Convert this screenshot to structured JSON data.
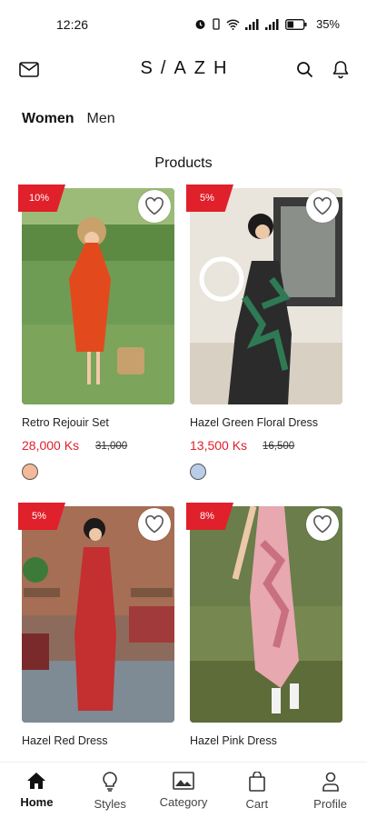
{
  "status_bar": {
    "time": "12:26",
    "battery": "35%"
  },
  "header": {
    "brand": "S/AZH"
  },
  "gender_tabs": [
    {
      "label": "Women",
      "active": true
    },
    {
      "label": "Men",
      "active": false
    }
  ],
  "section_title": "Products",
  "products": [
    {
      "name": "Retro Rejouir Set",
      "price": "28,000 Ks",
      "old_price": "31,000",
      "discount": "10%",
      "swatch": "#f4b89a"
    },
    {
      "name": "Hazel Green Floral Dress",
      "price": "13,500 Ks",
      "old_price": "16,500",
      "discount": "5%",
      "swatch": "#b9cde8"
    },
    {
      "name": "Hazel Red Dress",
      "discount": "5%"
    },
    {
      "name": "Hazel Pink Dress",
      "discount": "8%"
    }
  ],
  "bottom_nav": [
    {
      "label": "Home",
      "icon": "home-icon",
      "active": true
    },
    {
      "label": "Styles",
      "icon": "bulb-icon",
      "active": false
    },
    {
      "label": "Category",
      "icon": "image-icon",
      "active": false
    },
    {
      "label": "Cart",
      "icon": "bag-icon",
      "active": false
    },
    {
      "label": "Profile",
      "icon": "person-icon",
      "active": false
    }
  ],
  "colors": {
    "accent": "#e0202b"
  }
}
